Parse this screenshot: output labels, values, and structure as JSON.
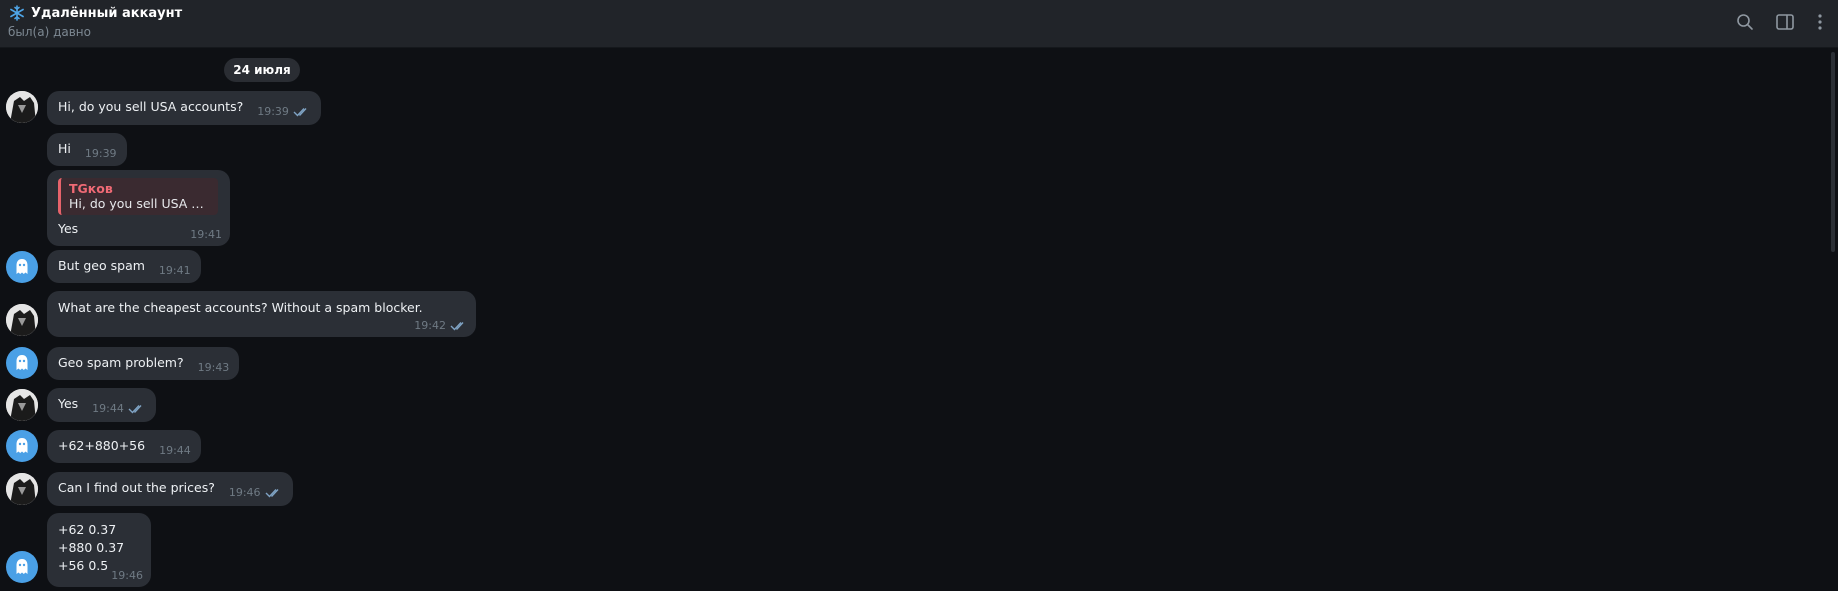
{
  "header": {
    "title": "Удалённый аккаунт",
    "status": "был(а) давно",
    "icons": [
      "snowflake-icon",
      "search-icon",
      "sidebar-toggle-icon",
      "more-vertical-icon"
    ]
  },
  "date_label": "24 июля",
  "messages": [
    {
      "text": "Hi, do you sell USA accounts?",
      "time": "19:39",
      "read": true
    },
    {
      "text": "Hi",
      "time": "19:39"
    },
    {
      "reply_name": "TGков",
      "reply_text": "Hi, do you sell USA acc...",
      "text": "Yes",
      "time": "19:41"
    },
    {
      "text": "But geo spam",
      "time": "19:41"
    },
    {
      "text": "What are the cheapest accounts? Without a spam blocker.",
      "time": "19:42",
      "read": true
    },
    {
      "text": "Geo spam problem?",
      "time": "19:43"
    },
    {
      "text": "Yes",
      "time": "19:44",
      "read": true
    },
    {
      "text": "+62+880+56",
      "time": "19:44"
    },
    {
      "text": "Can I find out the prices?",
      "time": "19:46",
      "read": true
    },
    {
      "lines": [
        "+62 0.37",
        "+880 0.37",
        "+56 0.5"
      ],
      "time": "19:46"
    }
  ],
  "colors": {
    "background": "#0e1014",
    "header": "#212429",
    "bubble": "#2b2f36",
    "ghost_avatar": "#4aa0e6",
    "reply_accent": "#e6636b"
  }
}
